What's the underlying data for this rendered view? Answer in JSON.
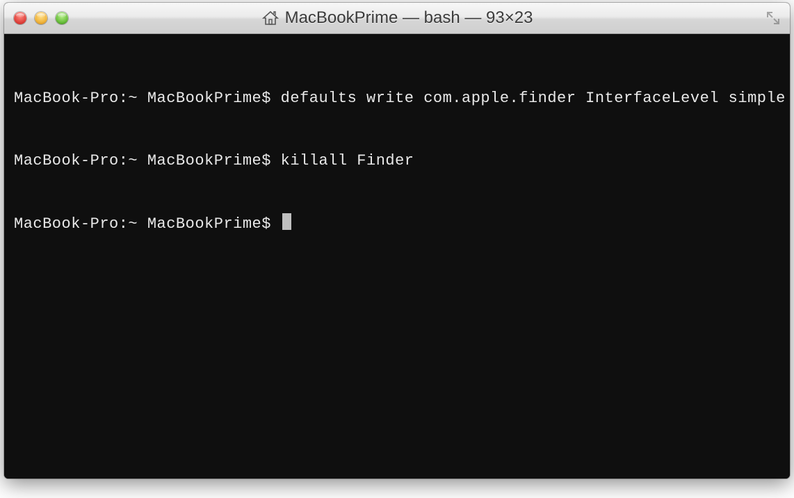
{
  "window": {
    "title": "MacBookPrime — bash — 93×23"
  },
  "terminal": {
    "lines": [
      {
        "prompt": "MacBook-Pro:~ MacBookPrime$ ",
        "command": "defaults write com.apple.finder InterfaceLevel simple"
      },
      {
        "prompt": "MacBook-Pro:~ MacBookPrime$ ",
        "command": "killall Finder"
      },
      {
        "prompt": "MacBook-Pro:~ MacBookPrime$ ",
        "command": ""
      }
    ]
  }
}
